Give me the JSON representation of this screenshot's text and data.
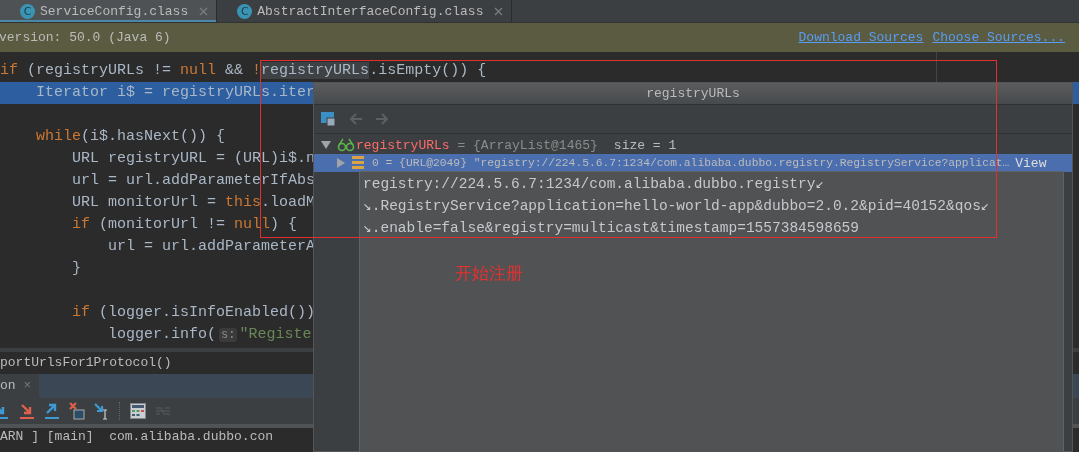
{
  "tabs": [
    {
      "icon": "C",
      "label": "ServiceConfig.class",
      "selected": true
    },
    {
      "icon": "C",
      "label": "AbstractInterfaceConfig.class",
      "selected": false
    }
  ],
  "banner": {
    "text": "version: 50.0 (Java 6)",
    "links": [
      "Download Sources",
      "Choose Sources..."
    ]
  },
  "code_lines": [
    {
      "current": false,
      "segments": [
        {
          "kind": "keyword",
          "text": "if"
        },
        {
          "kind": "plain",
          "text": " (registryURLs != "
        },
        {
          "kind": "keyword",
          "text": "null"
        },
        {
          "kind": "plain",
          "text": " && "
        },
        {
          "kind": "keyword",
          "text": "!"
        },
        {
          "kind": "usage",
          "text": "registryURLs"
        },
        {
          "kind": "plain",
          "text": ".isEmpty()) {"
        }
      ],
      "children": [
        {
          "current": true,
          "segments": [
            {
              "kind": "plain",
              "text": "Iterator i$ = registryURLs.iter"
            }
          ]
        },
        {
          "current": false
        },
        {
          "current": false,
          "segments": [
            {
              "kind": "keyword",
              "text": "while"
            },
            {
              "kind": "plain",
              "text": "(i$.hasNext()) {"
            }
          ],
          "children": [
            {
              "current": false,
              "segments": [
                {
                  "kind": "plain",
                  "text": "URL registryURL = (URL)i$.n"
                }
              ]
            },
            {
              "current": false,
              "segments": [
                {
                  "kind": "plain",
                  "text": "url = url.addParameterIfAbs"
                }
              ]
            },
            {
              "current": false,
              "segments": [
                {
                  "kind": "plain",
                  "text": "URL monitorUrl = "
                },
                {
                  "kind": "keyword",
                  "text": "this"
                },
                {
                  "kind": "plain",
                  "text": ".loadM"
                }
              ]
            },
            {
              "current": false,
              "segments": [
                {
                  "kind": "keyword",
                  "text": "if"
                },
                {
                  "kind": "plain",
                  "text": " (monitorUrl != "
                },
                {
                  "kind": "keyword",
                  "text": "null"
                },
                {
                  "kind": "plain",
                  "text": ") {"
                }
              ],
              "children": [
                {
                  "current": false,
                  "segments": [
                    {
                      "kind": "plain",
                      "text": "url = url.addParameterA"
                    }
                  ]
                }
              ]
            },
            {
              "current": false,
              "segments": [
                {
                  "kind": "plain",
                  "text": "}"
                }
              ]
            },
            {
              "current": false
            },
            {
              "current": false,
              "segments": [
                {
                  "kind": "keyword",
                  "text": "if"
                },
                {
                  "kind": "plain",
                  "text": " (logger.isInfoEnabled())"
                }
              ],
              "children": [
                {
                  "current": false,
                  "segments": [
                    {
                      "kind": "plain",
                      "text": "logger.info("
                    },
                    {
                      "kind": "hint",
                      "text": "s:"
                    },
                    {
                      "kind": "string",
                      "text": "\"Registe"
                    }
                  ]
                }
              ]
            }
          ]
        }
      ]
    }
  ],
  "breadcrumb": "portUrlsFor1Protocol()",
  "debug_tab": {
    "label": "on",
    "close": "×"
  },
  "debug_toolbar": [
    {
      "kind": "step-into",
      "disabled": false
    },
    {
      "kind": "force-step-into",
      "disabled": false
    },
    {
      "kind": "step-out",
      "disabled": false
    },
    {
      "kind": "drop-frame",
      "disabled": false
    },
    {
      "kind": "run-to-cursor",
      "disabled": false
    },
    {
      "kind": "evaluate",
      "disabled": false
    },
    {
      "kind": "trace",
      "disabled": true
    }
  ],
  "console": "ARN ] [main]  com.alibaba.dubbo.con",
  "popup": {
    "title": "registryURLs",
    "toolbar": [
      {
        "kind": "frames",
        "disabled": false
      },
      {
        "kind": "back",
        "disabled": true
      },
      {
        "kind": "forward",
        "disabled": true
      }
    ],
    "tree": [
      {
        "name": "registryURLs",
        "value": " = {ArrayList@1465}",
        "extra": "size = 1",
        "expanded": true,
        "selected": false,
        "children": [
          {
            "text": "0 = {URL@2049} \"registry://224.5.6.7:1234/com.alibaba.dubbo.registry.RegistryService?applicat…",
            "link": "View",
            "expanded": false,
            "selected": true
          }
        ]
      }
    ]
  },
  "tooltip": {
    "lines": [
      "registry://224.5.6.7:1234/com.alibaba.dubbo.registry↙",
      "↘.RegistryService?application=hello-world-app&dubbo=2.0.2&pid=40152&qos↙",
      "↘.enable=false&registry=multicast&timestamp=1557384598659"
    ]
  },
  "annotation": {
    "text": "开始注册"
  }
}
